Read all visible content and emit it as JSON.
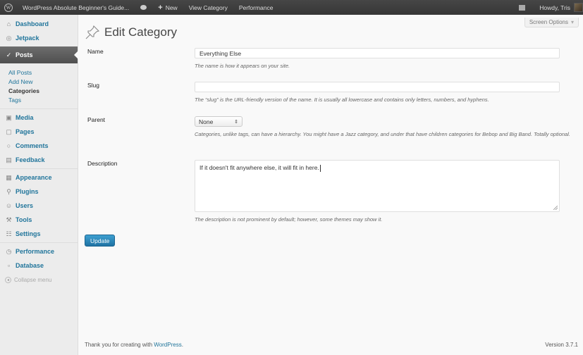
{
  "admin_bar": {
    "site_name": "WordPress Absolute Beginner's Guide...",
    "new_label": "New",
    "view_category": "View Category",
    "performance": "Performance",
    "greeting": "Howdy, Tris"
  },
  "sidebar": {
    "dashboard": "Dashboard",
    "jetpack": "Jetpack",
    "posts": "Posts",
    "posts_submenu": [
      "All Posts",
      "Add New",
      "Categories",
      "Tags"
    ],
    "media": "Media",
    "pages": "Pages",
    "comments": "Comments",
    "feedback": "Feedback",
    "appearance": "Appearance",
    "plugins": "Plugins",
    "users": "Users",
    "tools": "Tools",
    "settings": "Settings",
    "performance": "Performance",
    "database": "Database",
    "collapse": "Collapse menu"
  },
  "screen_options": "Screen Options",
  "page_title": "Edit Category",
  "form": {
    "name_label": "Name",
    "name_value": "Everything Else",
    "name_hint": "The name is how it appears on your site.",
    "slug_label": "Slug",
    "slug_value": "",
    "slug_hint": "The “slug” is the URL-friendly version of the name. It is usually all lowercase and contains only letters, numbers, and hyphens.",
    "parent_label": "Parent",
    "parent_value": "None",
    "parent_hint": "Categories, unlike tags, can have a hierarchy. You might have a Jazz category, and under that have children categories for Bebop and Big Band. Totally optional.",
    "description_label": "Description",
    "description_value": "If it doesn't fit anywhere else, it will fit in here.",
    "description_hint": "The description is not prominent by default; however, some themes may show it.",
    "update_label": "Update"
  },
  "footer": {
    "thanks_prefix": "Thank you for creating with ",
    "thanks_link": "WordPress",
    "thanks_suffix": ".",
    "version": "Version 3.7.1"
  }
}
